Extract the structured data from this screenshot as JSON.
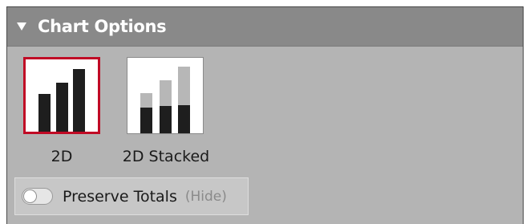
{
  "panel": {
    "title": "Chart Options",
    "collapse_icon": "triangle-down-icon"
  },
  "options": [
    {
      "label": "2D",
      "icon": "bar-chart-icon",
      "selected": true
    },
    {
      "label": "2D Stacked",
      "icon": "stacked-bar-chart-icon",
      "selected": false
    }
  ],
  "preserve_totals": {
    "label": "Preserve Totals",
    "hide_label": "(Hide)",
    "enabled": false
  },
  "colors": {
    "selected_border": "#c00a25",
    "header_bg": "#898989",
    "panel_bg": "#b4b4b4",
    "bar_dark": "#1e1e1e",
    "bar_light": "#b7b7b7"
  }
}
